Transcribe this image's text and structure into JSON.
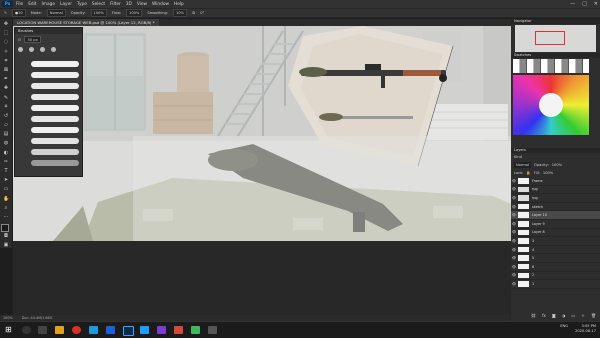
{
  "app": {
    "logo": "Ps"
  },
  "menu": [
    "File",
    "Edit",
    "Image",
    "Layer",
    "Type",
    "Select",
    "Filter",
    "3D",
    "View",
    "Window",
    "Help"
  ],
  "window_controls": [
    "—",
    "□",
    "✕"
  ],
  "options_bar": {
    "mode_label": "Mode:",
    "mode_value": "Normal",
    "opacity_label": "Opacity:",
    "opacity_value": "100%",
    "flow_label": "Flow:",
    "flow_value": "100%",
    "smoothing_label": "Smoothing:",
    "smoothing_value": "10%",
    "angle_value": "0°"
  },
  "document_tab": "LOCATION WAREHOUSE STORAGE WEB.psd @ 100% (Layer 12, RGB/8) *",
  "brushes_panel": {
    "title": "Brushes",
    "size_value": "30 px"
  },
  "navigator_title": "Navigator",
  "swatches_title": "Swatches",
  "layers_panel": {
    "title": "Layers",
    "filter_label": "Kind",
    "blend_mode": "Normal",
    "opacity_label": "Opacity:",
    "opacity_value": "100%",
    "lock_label": "Lock:",
    "fill_label": "Fill:",
    "fill_value": "100%",
    "items": [
      {
        "name": "Frame"
      },
      {
        "name": "rpg"
      },
      {
        "name": "rpg"
      },
      {
        "name": "sketch"
      },
      {
        "name": "Layer 10",
        "selected": true
      },
      {
        "name": "Layer 9"
      },
      {
        "name": "Layer 8"
      },
      {
        "name": "3"
      },
      {
        "name": "4"
      },
      {
        "name": "5"
      },
      {
        "name": "6"
      },
      {
        "name": "2"
      },
      {
        "name": "1"
      }
    ]
  },
  "status_bar": {
    "zoom": "100%",
    "doc": "Doc: 44.4M/1.66G"
  },
  "taskbar": {
    "time": "3:05 PM",
    "date": "2020-08-17",
    "language": "ENG"
  },
  "colors": {
    "ui_dark": "#323232",
    "canvas_bg": "#d9d9d7",
    "selected_layer": "#4a4a4a",
    "taskbar": "#1b1b1b"
  }
}
